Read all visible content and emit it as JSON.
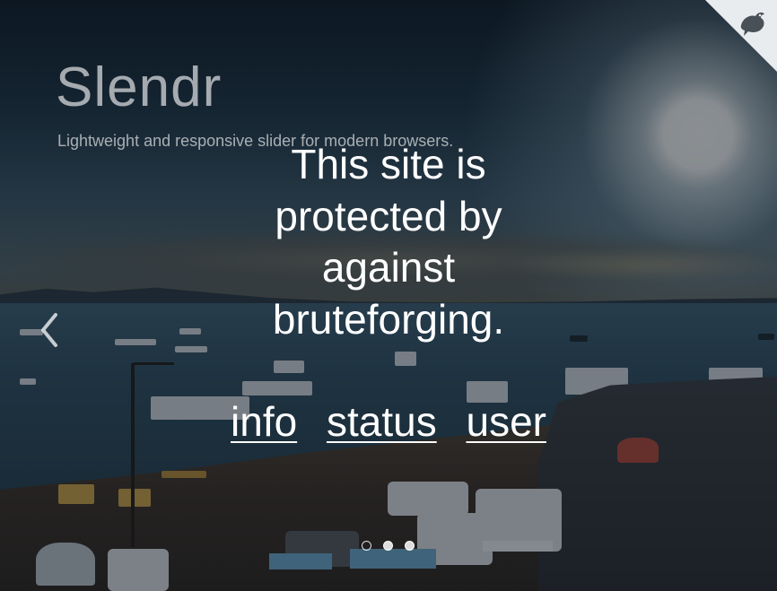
{
  "hero": {
    "title": "Slendr",
    "subtitle": "Lightweight and responsive slider for modern browsers."
  },
  "notice": {
    "message": "This site is protected by against bruteforging."
  },
  "links": [
    {
      "label": "info"
    },
    {
      "label": "status"
    },
    {
      "label": "user"
    }
  ],
  "slider": {
    "prev_icon": "chevron-left-icon",
    "dots": [
      {
        "state": "active"
      },
      {
        "state": "inactive"
      },
      {
        "state": "inactive"
      }
    ]
  },
  "corner": {
    "icon": "bird-logo-icon",
    "color": "#e9ecee"
  },
  "colors": {
    "text": "#ffffff",
    "overlay": "#0a121a"
  }
}
